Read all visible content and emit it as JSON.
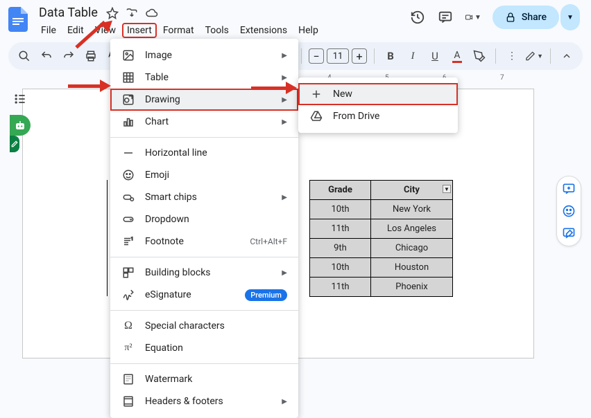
{
  "header": {
    "doc_title": "Data Table",
    "menus": [
      "File",
      "Edit",
      "View",
      "Insert",
      "Format",
      "Tools",
      "Extensions",
      "Help"
    ],
    "share_label": "Share"
  },
  "toolbar": {
    "font_size": "11"
  },
  "insert_menu": {
    "items": [
      {
        "label": "Image",
        "arrow": true
      },
      {
        "label": "Table",
        "arrow": true
      },
      {
        "label": "Drawing",
        "arrow": true,
        "highlighted": true,
        "hovered": true
      },
      {
        "label": "Chart",
        "arrow": true
      },
      {
        "sep": true
      },
      {
        "label": "Horizontal line"
      },
      {
        "label": "Emoji"
      },
      {
        "label": "Smart chips",
        "arrow": true
      },
      {
        "label": "Dropdown"
      },
      {
        "label": "Footnote",
        "shortcut": "Ctrl+Alt+F"
      },
      {
        "sep": true
      },
      {
        "label": "Building blocks",
        "arrow": true
      },
      {
        "label": "eSignature",
        "badge": "Premium"
      },
      {
        "sep": true
      },
      {
        "label": "Special characters"
      },
      {
        "label": "Equation"
      },
      {
        "sep": true
      },
      {
        "label": "Watermark"
      },
      {
        "label": "Headers & footers",
        "arrow": true
      }
    ]
  },
  "drawing_submenu": {
    "items": [
      {
        "label": "New",
        "highlighted": true,
        "hovered": true
      },
      {
        "label": "From Drive"
      }
    ]
  },
  "ruler": {
    "marks": [
      "4",
      "5",
      "6",
      "7"
    ]
  },
  "table": {
    "headers": [
      "Grade",
      "City"
    ],
    "rows": [
      [
        "10th",
        "New York"
      ],
      [
        "11th",
        "Los Angeles"
      ],
      [
        "9th",
        "Chicago"
      ],
      [
        "10th",
        "Houston"
      ],
      [
        "11th",
        "Phoenix"
      ]
    ]
  }
}
